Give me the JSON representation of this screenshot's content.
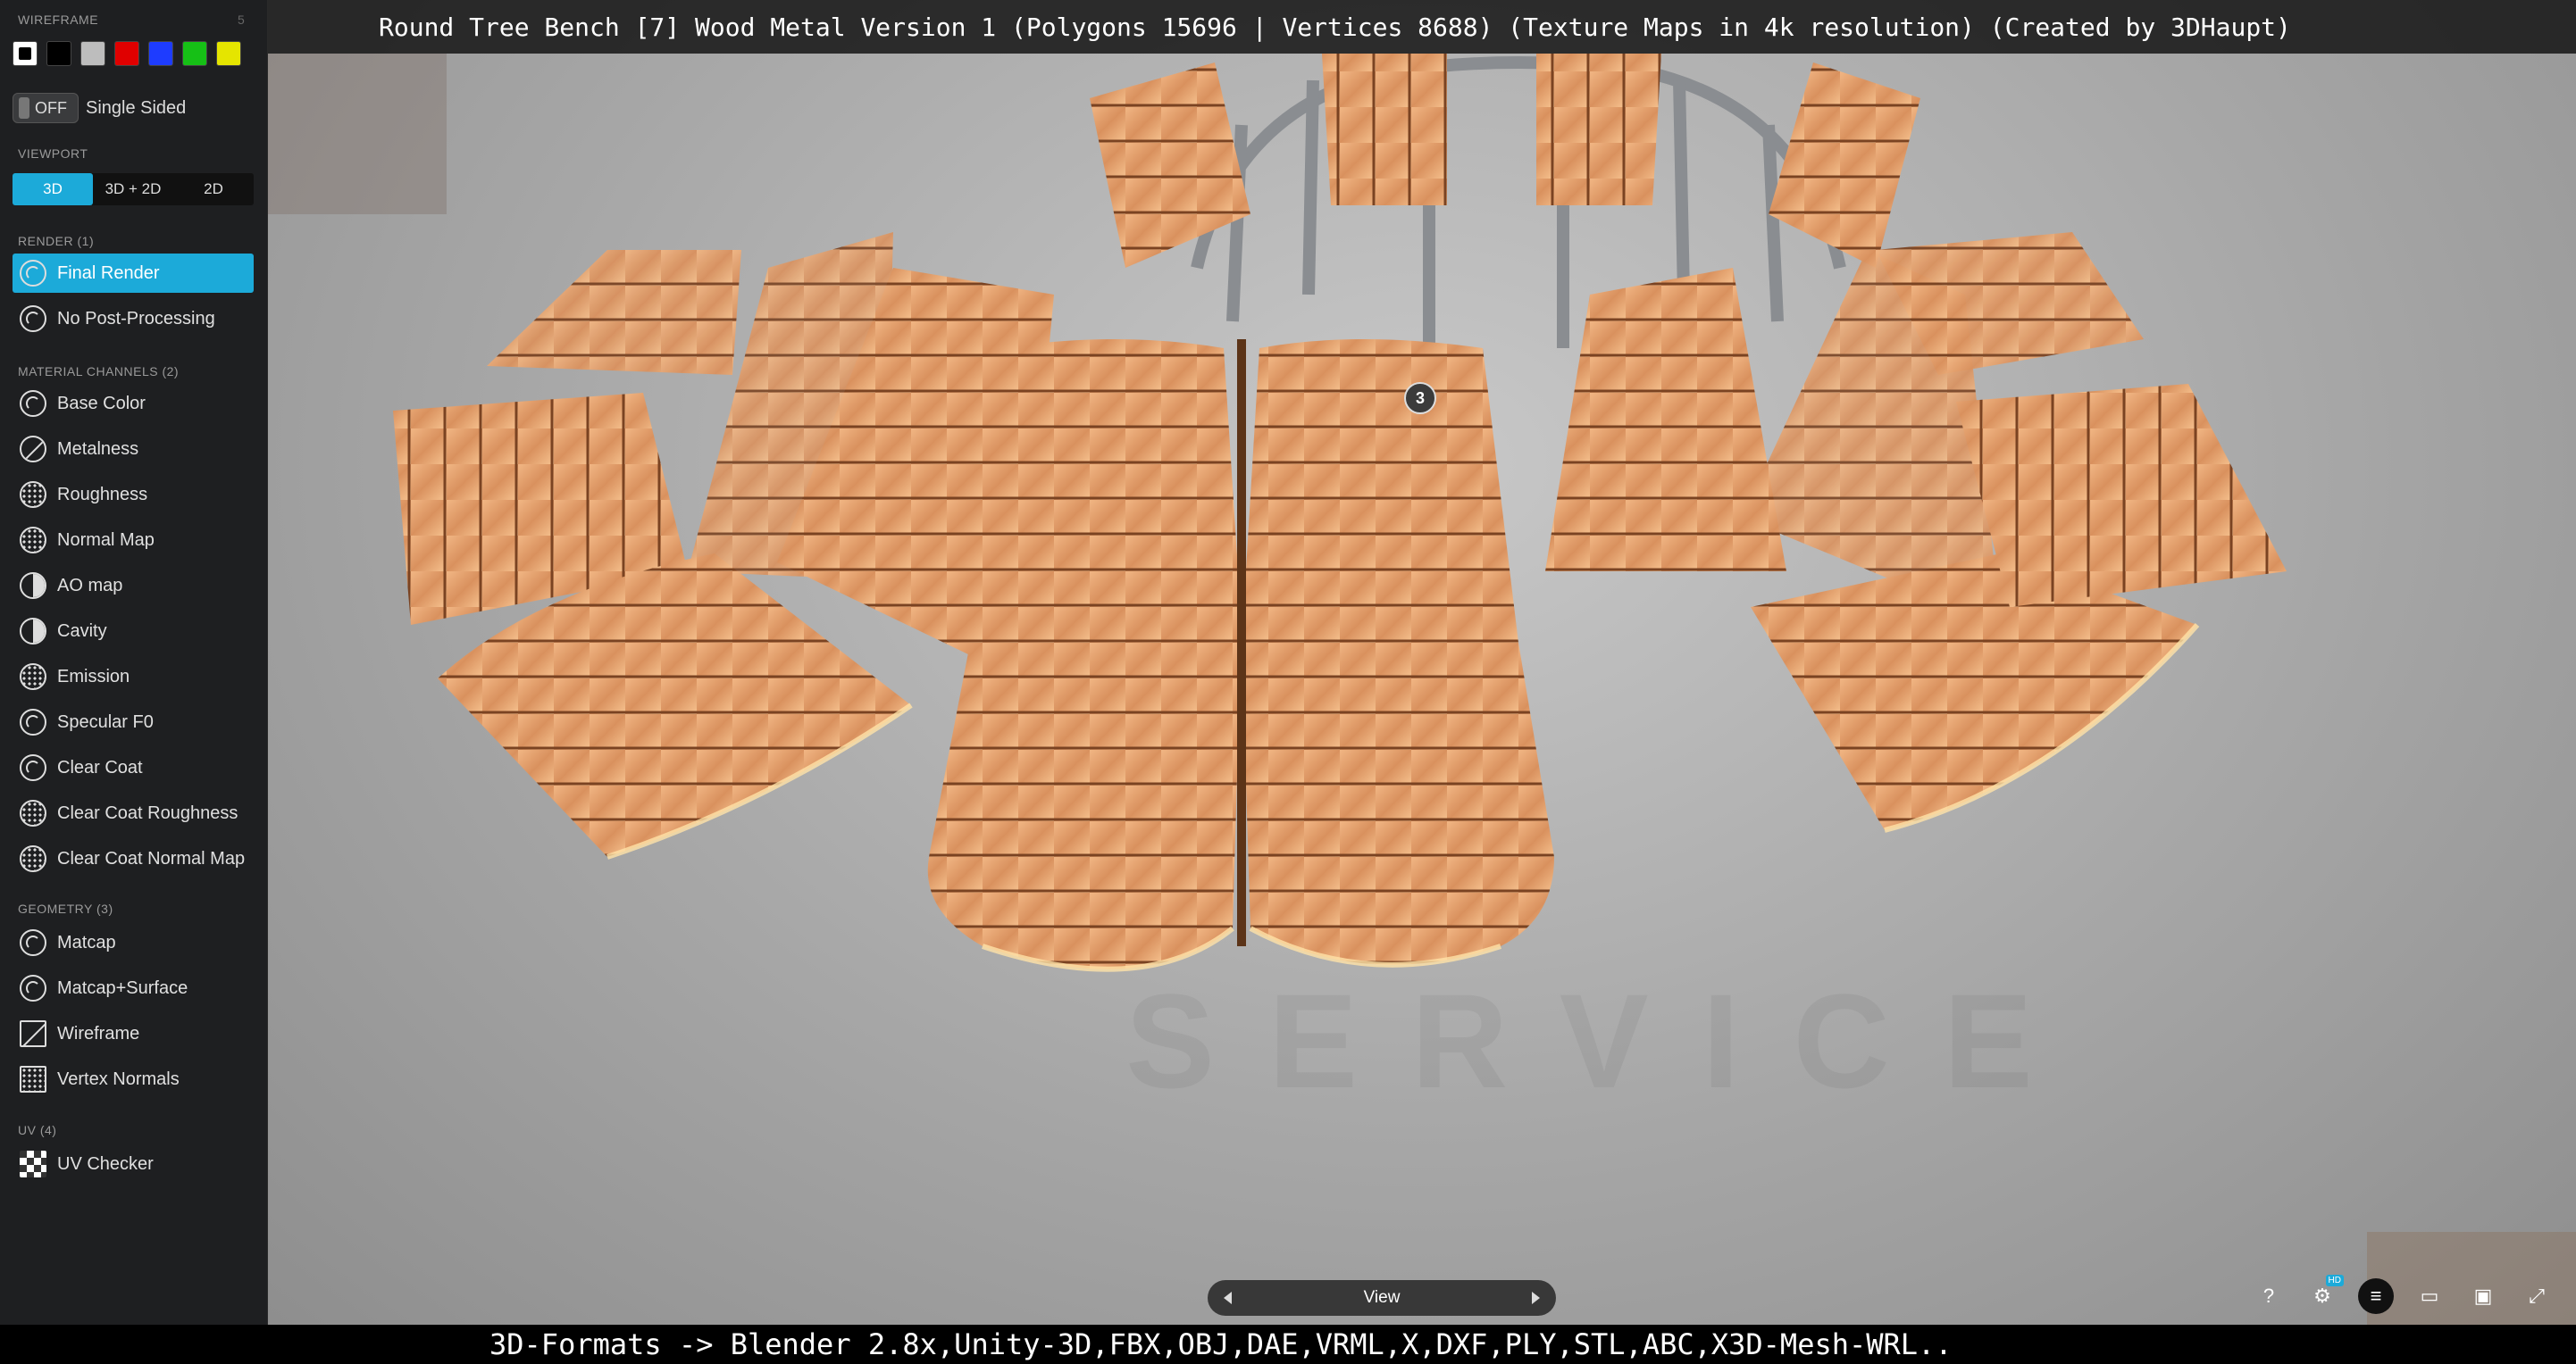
{
  "title": "Round Tree Bench [7] Wood Metal Version 1 (Polygons 15696 | Vertices 8688) (Texture Maps in 4k resolution) (Created by 3DHaupt)",
  "sidebar": {
    "wireframe_label": "WIREFRAME",
    "wireframe_count": "5",
    "swatch_colors": [
      "#ffffff",
      "#000000",
      "#bdbdbd",
      "#e00000",
      "#1e3cff",
      "#16c016",
      "#e5e500"
    ],
    "single_sided_toggle": "OFF",
    "single_sided_label": "Single Sided",
    "viewport_label": "VIEWPORT",
    "viewport_tabs": [
      "3D",
      "3D + 2D",
      "2D"
    ],
    "render_label": "RENDER (1)",
    "render_items": [
      "Final Render",
      "No Post-Processing"
    ],
    "material_label": "MATERIAL CHANNELS (2)",
    "material_items": [
      "Base Color",
      "Metalness",
      "Roughness",
      "Normal Map",
      "AO map",
      "Cavity",
      "Emission",
      "Specular F0",
      "Clear Coat",
      "Clear Coat Roughness",
      "Clear Coat Normal Map"
    ],
    "geometry_label": "GEOMETRY (3)",
    "geometry_items": [
      "Matcap",
      "Matcap+Surface",
      "Wireframe",
      "Vertex Normals"
    ],
    "uv_label": "UV (4)",
    "uv_items": [
      "UV Checker"
    ]
  },
  "viewport": {
    "hotspot_number": "3",
    "view_label": "View",
    "hd_badge": "HD",
    "help_icon_text": "?"
  },
  "footer": "3D-Formats -> Blender 2.8x,Unity-3D,FBX,OBJ,DAE,VRML,X,DXF,PLY,STL,ABC,X3D-Mesh-WRL..",
  "colors": {
    "accent": "#1caad9",
    "wood": "#e9a36f"
  }
}
